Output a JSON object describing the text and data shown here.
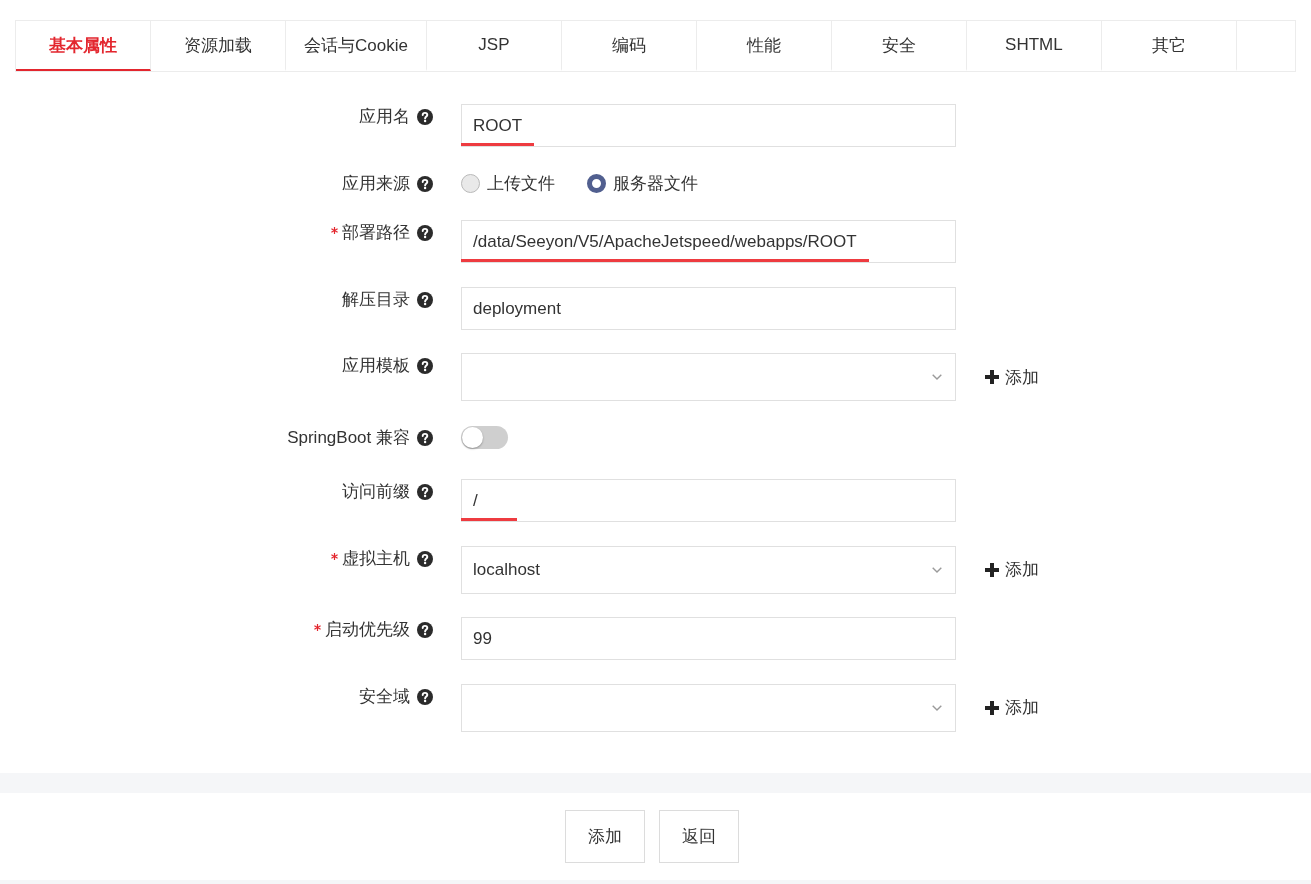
{
  "tabs": [
    {
      "label": "基本属性",
      "selected": true
    },
    {
      "label": "资源加载",
      "selected": false
    },
    {
      "label": "会话与Cookie",
      "selected": false
    },
    {
      "label": "JSP",
      "selected": false
    },
    {
      "label": "编码",
      "selected": false
    },
    {
      "label": "性能",
      "selected": false
    },
    {
      "label": "安全",
      "selected": false
    },
    {
      "label": "SHTML",
      "selected": false
    },
    {
      "label": "其它",
      "selected": false
    }
  ],
  "form": {
    "fields": [
      {
        "kind": "text",
        "label": "应用名",
        "required": false,
        "value": "ROOT",
        "underlined": true
      },
      {
        "kind": "radio",
        "label": "应用来源",
        "required": false,
        "options": [
          {
            "label": "上传文件",
            "selected": false
          },
          {
            "label": "服务器文件",
            "selected": true
          }
        ]
      },
      {
        "kind": "text",
        "label": "部署路径",
        "required": true,
        "value": "/data/Seeyon/V5/ApacheJetspeed/webapps/ROOT",
        "underlined": true
      },
      {
        "kind": "text",
        "label": "解压目录",
        "required": false,
        "value": "deployment",
        "underlined": false
      },
      {
        "kind": "select",
        "label": "应用模板",
        "required": false,
        "add_label": "添加"
      },
      {
        "kind": "toggle",
        "label": "SpringBoot 兼容",
        "required": false,
        "on": false
      },
      {
        "kind": "text",
        "label": "访问前缀",
        "required": false,
        "value": "/",
        "underlined": true
      },
      {
        "kind": "select",
        "label": "虚拟主机",
        "required": true,
        "value": "localhost",
        "add_label": "添加"
      },
      {
        "kind": "text",
        "label": "启动优先级",
        "required": true,
        "value": "99",
        "underlined": false
      },
      {
        "kind": "select",
        "label": "安全域",
        "required": false,
        "add_label": "添加"
      }
    ]
  },
  "buttons": [
    {
      "label": "添加"
    },
    {
      "label": "返回"
    }
  ]
}
